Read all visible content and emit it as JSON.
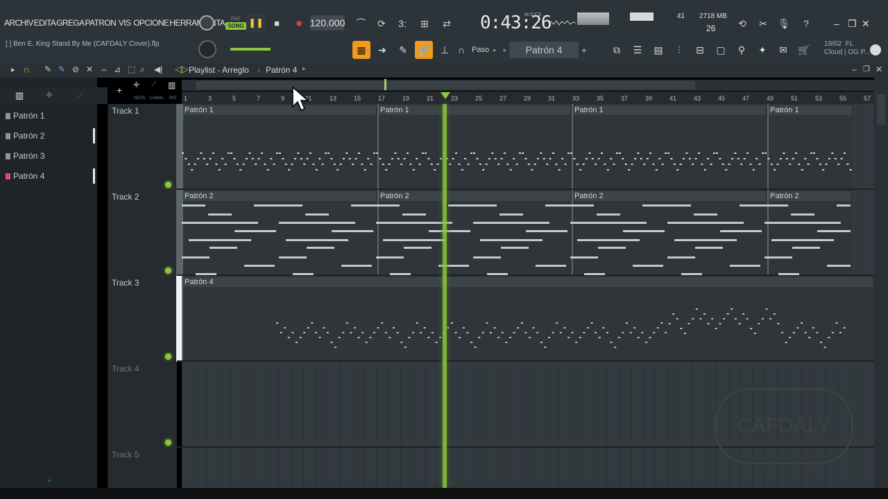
{
  "menu": {
    "items": [
      "ARCHIV",
      "EDITA",
      "GREGA",
      "PATRON",
      "VIS",
      "OPCIONE",
      "HERRAMIENTA"
    ]
  },
  "song_title": "[ ] Ben E. King Stand By Me (CAFDALY Cover).flp",
  "transport": {
    "pat_label": "PAT",
    "song_label": "SONG",
    "tempo": "120.000",
    "time": "0:43:26",
    "time_unit": "M:S:CS"
  },
  "system": {
    "cpu": "41",
    "memory": "2718 MB",
    "polyphony": "26"
  },
  "toolbar": {
    "snap_label": "Paso",
    "pattern_selector": "Patrón 4"
  },
  "news": {
    "date": "19/02",
    "src": "FL",
    "line2": "Cloud | OG P..."
  },
  "playlist": {
    "title": "Playlist - Arreglo",
    "breadcrumb": "Patrón 4"
  },
  "patterns": [
    "Patrón 1",
    "Patrón 2",
    "Patrón 3",
    "Patrón 4"
  ],
  "tracks": [
    "Track 1",
    "Track 2",
    "Track 3",
    "Track 4",
    "Track 5"
  ],
  "clips": {
    "p1": "Patrón 1",
    "p2": "Patrón 2",
    "p4": "Patrón 4"
  },
  "ruler": [
    "1",
    "3",
    "5",
    "7",
    "9",
    "11",
    "13",
    "15",
    "17",
    "19",
    "21",
    "23",
    "25",
    "27",
    "29",
    "31",
    "33",
    "35",
    "37",
    "39",
    "41",
    "43",
    "45",
    "47",
    "49",
    "51",
    "53",
    "55",
    "57"
  ],
  "side_labels": {
    "nota": "NOTA",
    "canal": "CANAL",
    "pat": "PAT"
  },
  "watermark": "CAFDALY"
}
